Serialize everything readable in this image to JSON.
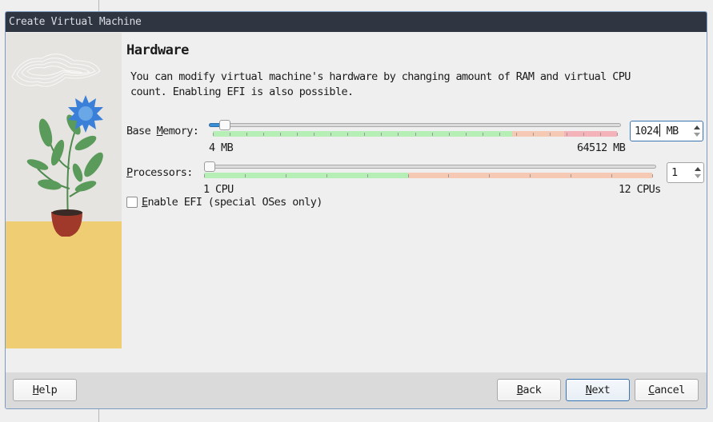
{
  "window": {
    "title": "Create Virtual Machine"
  },
  "page": {
    "heading": "Hardware",
    "description_line1": "You can modify virtual machine's hardware by changing amount of RAM and virtual CPU",
    "description_line2": "count. Enabling EFI is also possible."
  },
  "memory": {
    "label_pre": "Base ",
    "label_mnemonic": "M",
    "label_post": "emory:",
    "min_label": "4 MB",
    "max_label": "64512 MB",
    "value": "1024",
    "unit": " MB",
    "min_value_mb": 4,
    "max_value_mb": 64512,
    "current_value_mb": 1024,
    "zones": {
      "green_end_fraction": 0.74,
      "orange_end_fraction": 0.87
    },
    "colors": {
      "green": "#b6efb6",
      "orange": "#f5c9b4",
      "red": "#f3b3b8"
    }
  },
  "processors": {
    "label_mnemonic": "P",
    "label_post": "rocessors:",
    "min_label": "1 CPU",
    "max_label": "12 CPUs",
    "value": "1",
    "min_value": 1,
    "max_value": 12,
    "current_value": 1,
    "zones": {
      "green_end_fraction": 0.455
    },
    "colors": {
      "green": "#b6efb6",
      "orange": "#f5c9b4"
    }
  },
  "efi": {
    "label_mnemonic": "E",
    "label_post": "nable EFI (special OSes only)",
    "checked": false
  },
  "buttons": {
    "help": {
      "mnemonic": "H",
      "rest": "elp"
    },
    "back": {
      "mnemonic": "B",
      "rest": "ack"
    },
    "next": {
      "mnemonic": "N",
      "rest": "ext"
    },
    "cancel": {
      "mnemonic": "C",
      "rest": "ancel"
    }
  },
  "colors": {
    "titlebar_bg": "#2f3541",
    "window_border": "#7c9bc0",
    "accent": "#3a8fd4",
    "footer_bg": "#dadada"
  }
}
